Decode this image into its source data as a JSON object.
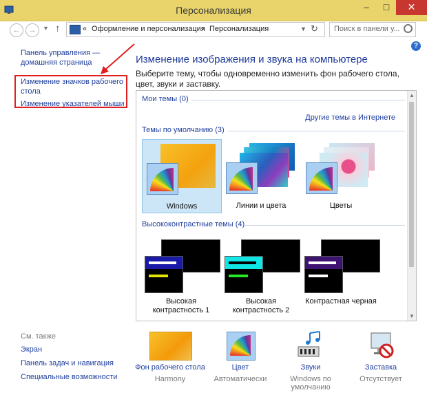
{
  "window": {
    "title": "Персонализация",
    "controls": {
      "minimize": "–",
      "maximize": "□",
      "close": "✕"
    }
  },
  "nav": {
    "back_icon": "back-arrow-icon",
    "forward_icon": "forward-arrow-icon",
    "up_icon": "up-arrow-icon",
    "breadcrumb_overflow": "«",
    "breadcrumb": [
      "Оформление и персонализация",
      "Персонализация"
    ],
    "breadcrumb_separator": "›",
    "search_placeholder": "Поиск в панели у..."
  },
  "sidebar": {
    "home_link": "Панель управления — домашняя страница",
    "links": [
      "Изменение значков рабочего стола",
      "Изменение указателей мыши"
    ],
    "see_also_title": "См. также",
    "see_also": [
      "Экран",
      "Панель задач и навигация",
      "Специальные возможности"
    ]
  },
  "main": {
    "title": "Изменение изображения и звука на компьютере",
    "description": "Выберите тему, чтобы одновременно изменить фон рабочего стола, цвет, звуки и заставку.",
    "my_themes": "Мои темы (0)",
    "online_link": "Другие темы в Интернете",
    "default_themes": "Темы по умолчанию (3)",
    "default_theme_items": [
      "Windows",
      "Линии и цвета",
      "Цветы"
    ],
    "selected_theme": "Windows",
    "hc_themes": "Высококонтрастные темы (4)",
    "hc_theme_items": [
      [
        "Высокая",
        "контрастность 1"
      ],
      [
        "Высокая",
        "контрастность 2"
      ],
      [
        "Контрастная черная"
      ]
    ]
  },
  "bottom": [
    {
      "name": "Фон рабочего стола",
      "value": "Harmony",
      "icon": "wallpaper-icon"
    },
    {
      "name": "Цвет",
      "value": "Автоматически",
      "icon": "color-palette-icon"
    },
    {
      "name": "Звуки",
      "value": "Windows по умолчанию",
      "icon": "sound-icon"
    },
    {
      "name": "Заставка",
      "value": "Отсутствует",
      "icon": "screensaver-icon"
    }
  ],
  "colors": {
    "titlebar": "#e8d46a",
    "accent": "#2e6fc9",
    "highlight": "#e02020",
    "link": "#1f3f9e",
    "close": "#c7372f"
  }
}
